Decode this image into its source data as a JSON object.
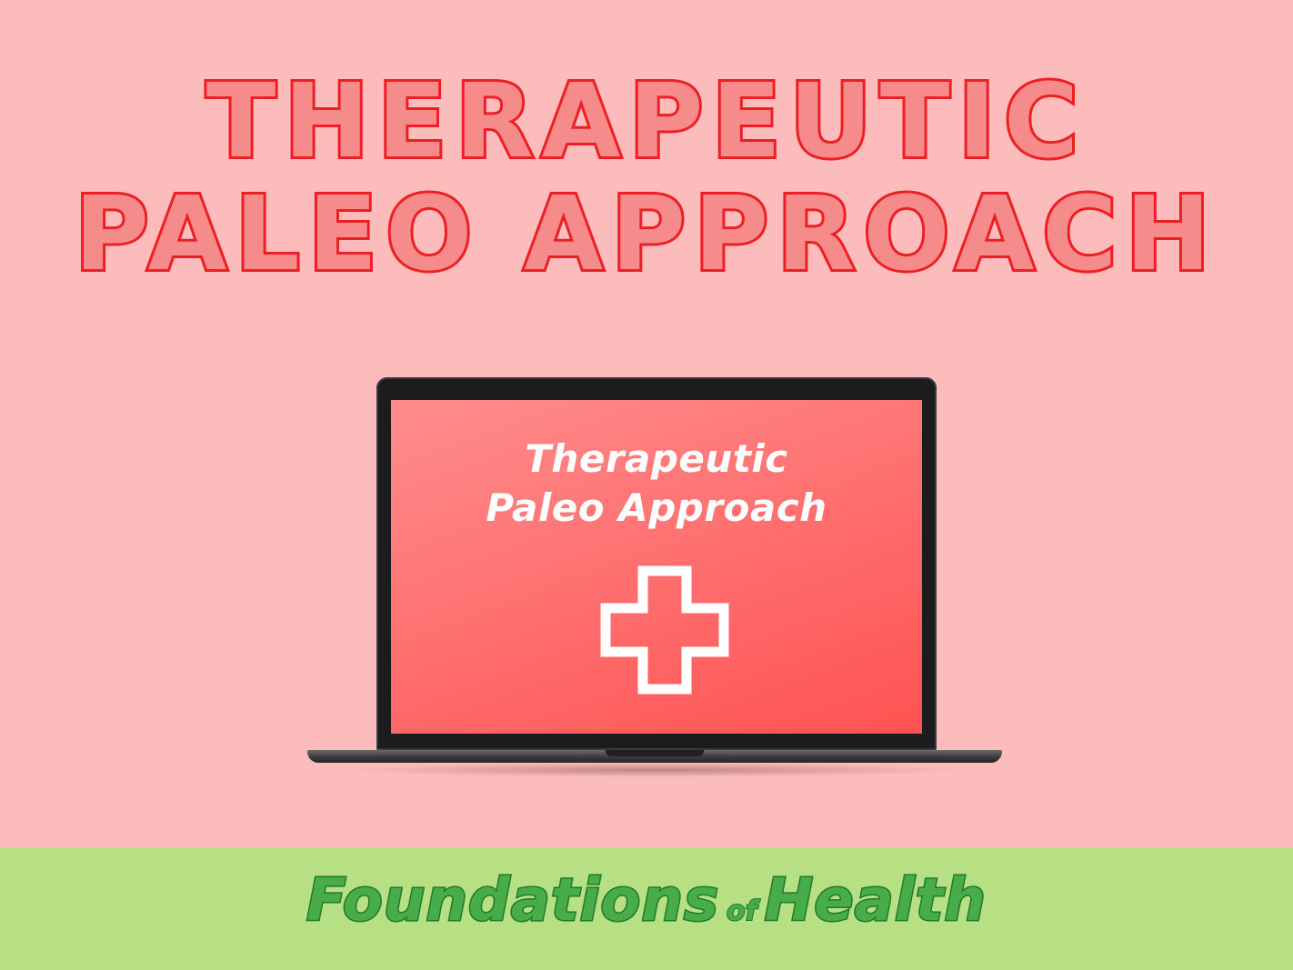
{
  "headline": {
    "line1": "THERAPEUTIC",
    "line2": "PALEO APPROACH"
  },
  "laptop_screen": {
    "title_line1": "Therapeutic",
    "title_line2": "Paleo Approach",
    "icon": "medical-cross-icon"
  },
  "footer": {
    "logo_word1": "Foundations",
    "logo_word2": "of",
    "logo_word3": "Health"
  },
  "colors": {
    "background": "#fdbcbc",
    "headline_fill": "#f58b8b",
    "headline_stroke": "#ee1f24",
    "screen": "#ff6b6b",
    "footer_background": "#b7df83",
    "footer_text": "#48ad48",
    "footer_text_stroke": "#1f7a2c"
  }
}
